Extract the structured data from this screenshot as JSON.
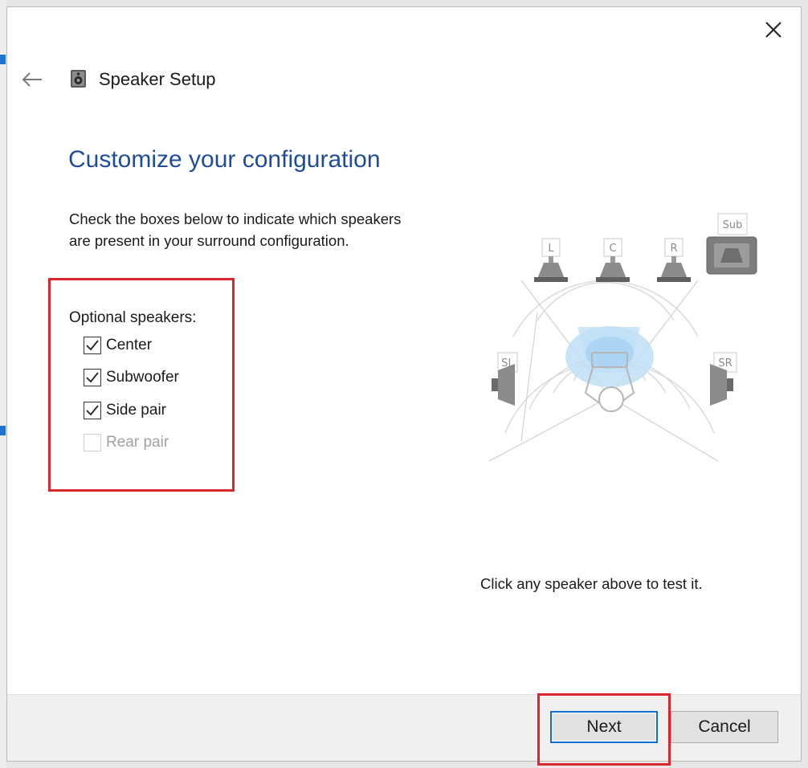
{
  "window": {
    "title": "Speaker Setup",
    "close_icon": "close-icon",
    "back_icon": "arrow-left-icon",
    "app_icon": "speaker-icon"
  },
  "page": {
    "heading": "Customize your configuration",
    "instructions_line1": "Check the boxes below to indicate which speakers",
    "instructions_line2": "are present in your surround configuration."
  },
  "options": {
    "title": "Optional speakers:",
    "items": [
      {
        "label": "Center",
        "checked": true,
        "enabled": true
      },
      {
        "label": "Subwoofer",
        "checked": true,
        "enabled": true
      },
      {
        "label": "Side pair",
        "checked": true,
        "enabled": true
      },
      {
        "label": "Rear pair",
        "checked": false,
        "enabled": false
      }
    ]
  },
  "diagram": {
    "speakers": {
      "left": "L",
      "center": "C",
      "right": "R",
      "sub": "Sub",
      "side_left": "SL",
      "side_right": "SR"
    }
  },
  "hint": "Click any speaker above to test it.",
  "buttons": {
    "next": "Next",
    "cancel": "Cancel"
  },
  "colors": {
    "heading": "#1f4c9a",
    "highlight": "#d9272e",
    "focus": "#0a6fd0"
  }
}
